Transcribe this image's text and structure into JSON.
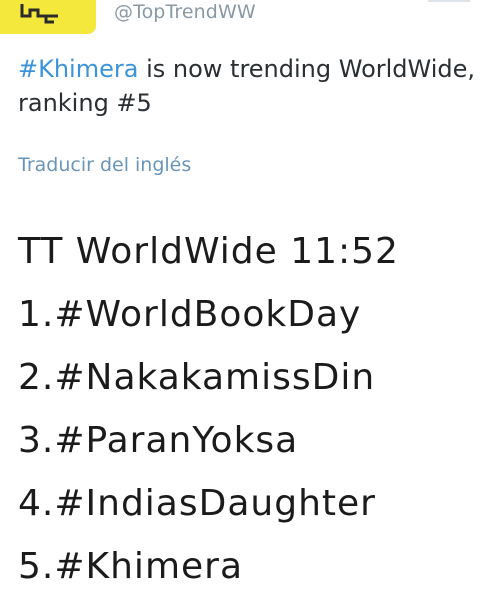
{
  "tweet": {
    "handle": "@TopTrendWW",
    "hashtag": "#Khimera",
    "text_rest": " is now trending WorldWide, ranking #5",
    "translate_link": "Traducir del inglés"
  },
  "image": {
    "header": "TT WorldWide 11:52",
    "trends": [
      "1.#WorldBookDay",
      "2.#NakakamissDin",
      "3.#ParanYoksa",
      "4.#IndiasDaughter",
      "5.#Khimera"
    ]
  },
  "colors": {
    "hashtag": "#3b94d9",
    "handle": "#8899a6",
    "avatar": "#f5e83c"
  }
}
